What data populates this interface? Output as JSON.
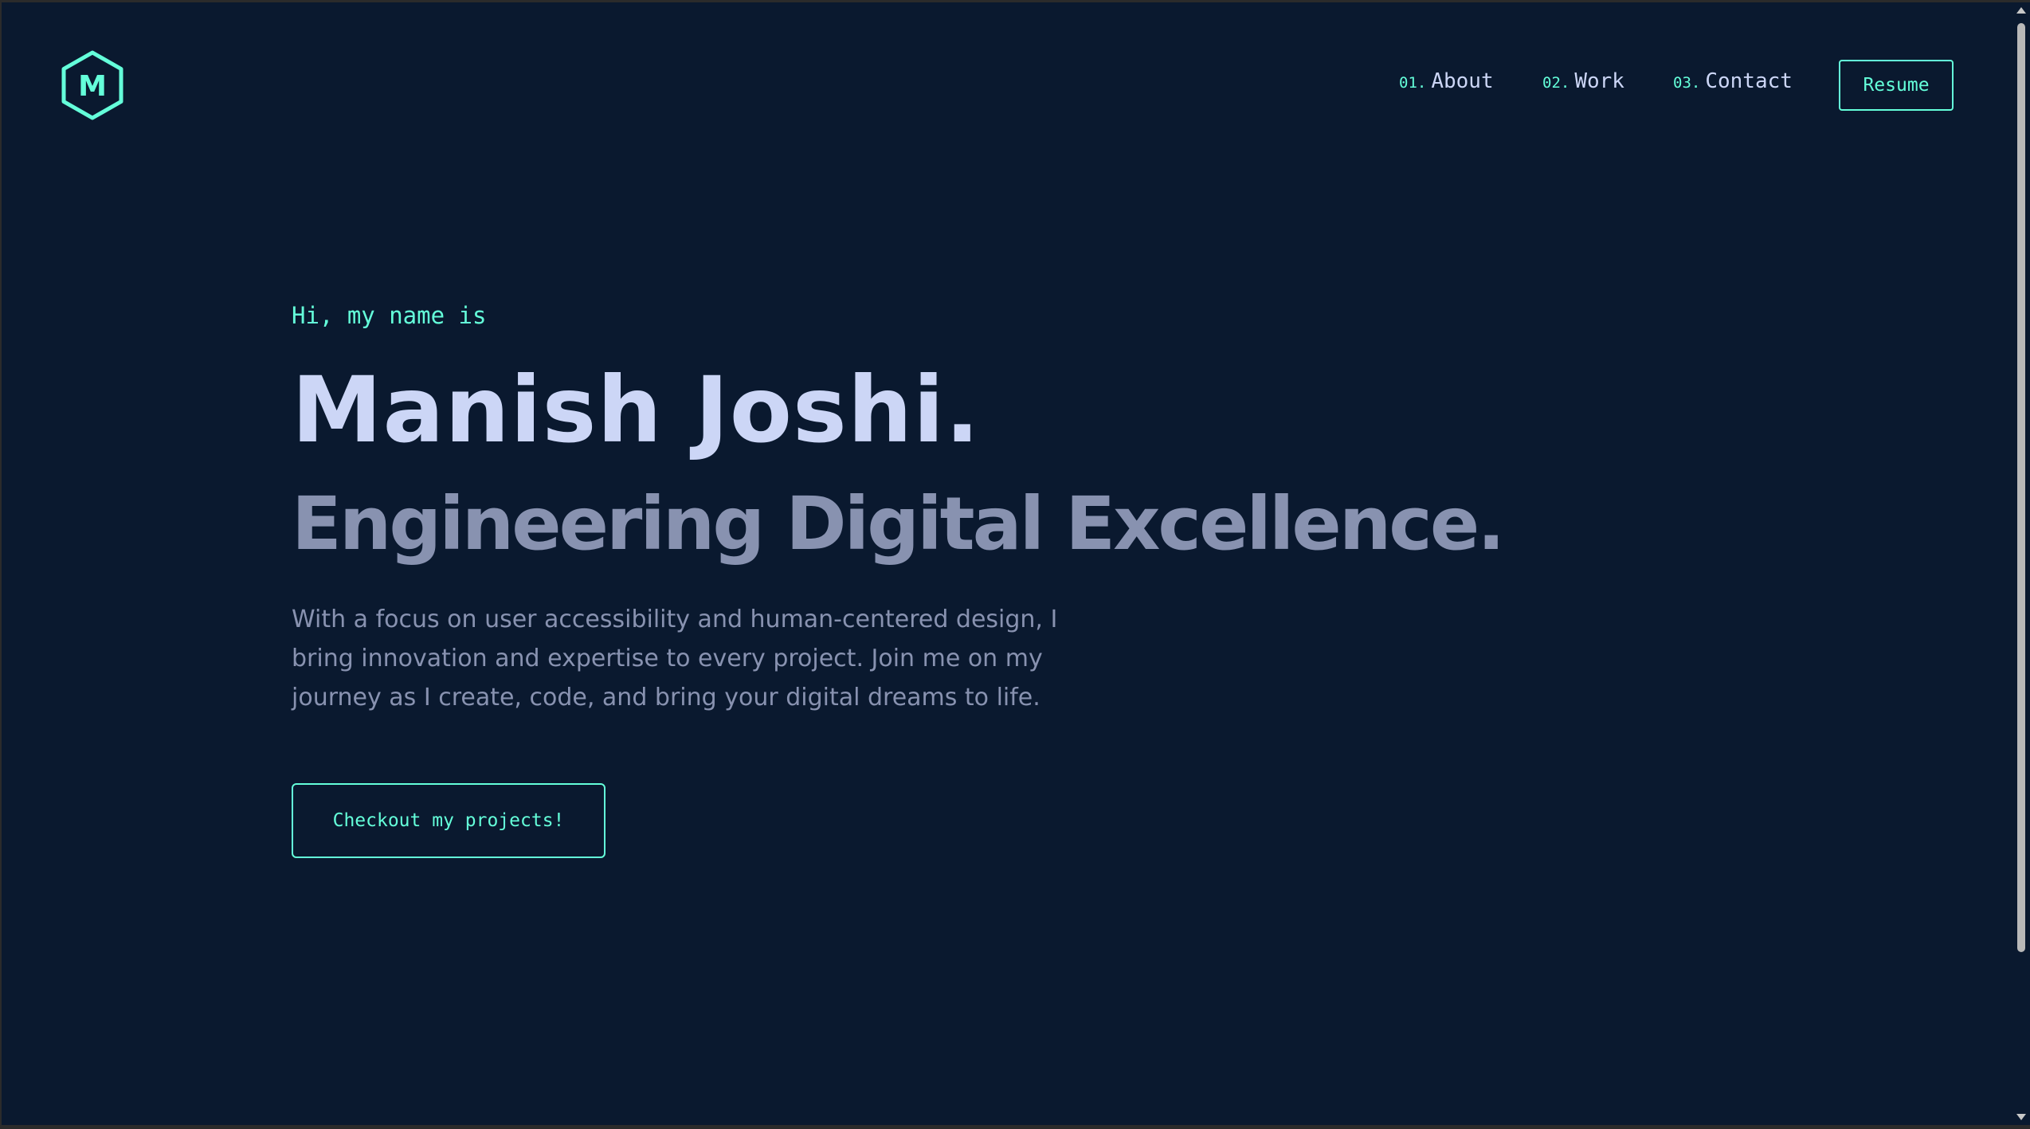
{
  "header": {
    "logo_letter": "M",
    "nav": [
      {
        "num": "01.",
        "label": "About"
      },
      {
        "num": "02.",
        "label": "Work"
      },
      {
        "num": "03.",
        "label": "Contact"
      }
    ],
    "resume_label": "Resume"
  },
  "hero": {
    "greeting": "Hi, my name is",
    "name": "Manish Joshi.",
    "tagline": "Engineering Digital Excellence.",
    "bio": "With a focus on user accessibility and human-centered design, I bring innovation and expertise to every project. Join me on my journey as I create, code, and bring your digital dreams to life.",
    "cta_label": "Checkout my projects!"
  },
  "colors": {
    "background": "#0a192f",
    "accent": "#64ffda",
    "heading": "#ccd6f6",
    "text": "#8892b0"
  },
  "icons": {
    "logo": "hexagon-logo-icon",
    "scroll_up": "chevron-up-icon",
    "scroll_down": "chevron-down-icon"
  }
}
